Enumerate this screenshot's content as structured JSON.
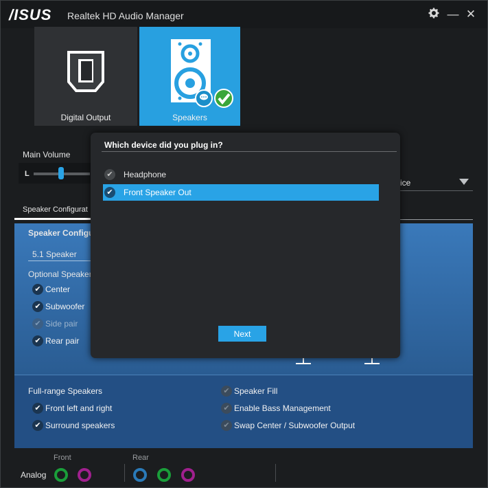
{
  "window": {
    "logo": "/ISUS",
    "title": "Realtek HD Audio Manager",
    "settings_icon": "gear-icon",
    "minimize_glyph": "—",
    "close_glyph": "✕"
  },
  "device_tabs": [
    {
      "label": "Digital Output",
      "icon": "digital-output-icon"
    },
    {
      "label": "Speakers",
      "icon": "speaker-icon",
      "selected": true
    }
  ],
  "main_volume": {
    "label": "Main Volume",
    "left_label": "L"
  },
  "default_device_partial": "ice",
  "tabs": {
    "speaker_configuration_partial": "Speaker Configurat"
  },
  "speaker_config": {
    "heading_partial": "Speaker Configu",
    "selected": "5.1 Speaker",
    "optional_heading_partial": "Optional Speaker",
    "options": [
      {
        "label": "Center",
        "checked": true,
        "enabled": true
      },
      {
        "label": "Subwoofer",
        "checked": true,
        "enabled": true
      },
      {
        "label": "Side pair",
        "checked": false,
        "enabled": false
      },
      {
        "label": "Rear pair",
        "checked": true,
        "enabled": true
      }
    ]
  },
  "full_range": {
    "heading": "Full-range Speakers",
    "items": [
      {
        "label": "Front left and right",
        "checked": true
      },
      {
        "label": "Surround speakers",
        "checked": true
      }
    ],
    "right_items": [
      {
        "label": "Speaker Fill",
        "checked": false
      },
      {
        "label": "Enable Bass Management",
        "checked": false
      },
      {
        "label": "Swap Center / Subwoofer Output",
        "checked": false
      }
    ]
  },
  "analog": {
    "label": "Analog",
    "front_label": "Front",
    "rear_label": "Rear",
    "colors": {
      "green": "#1a9e3a",
      "purple": "#a0208e",
      "blue": "#2a7ab8"
    }
  },
  "dialog": {
    "title": "Which device did you plug in?",
    "options": [
      {
        "label": "Headphone",
        "selected": false
      },
      {
        "label": "Front Speaker Out",
        "selected": true
      }
    ],
    "next_label": "Next"
  },
  "colors": {
    "accent": "#29a3e6",
    "panel_blue": "#3a79ba",
    "background": "#1b1d1f"
  }
}
